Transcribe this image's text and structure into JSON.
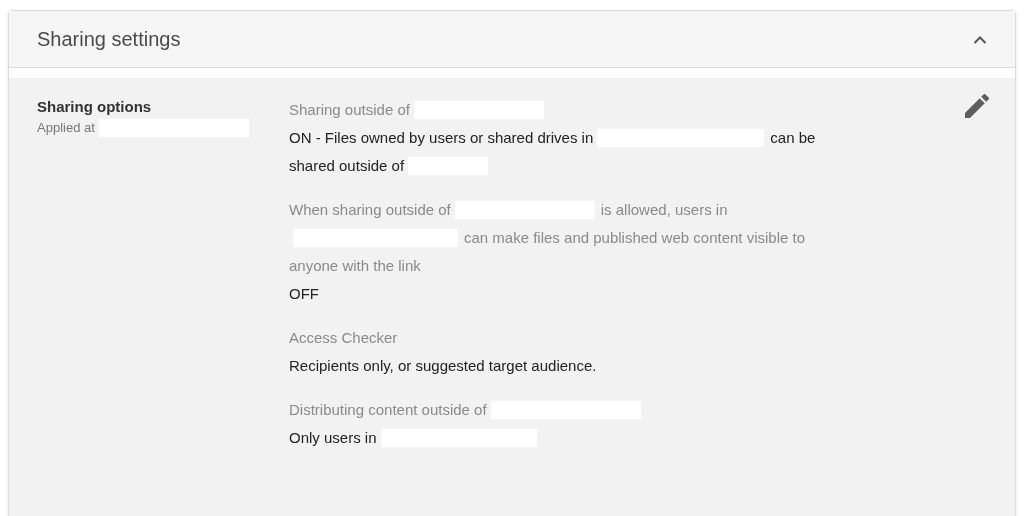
{
  "panel": {
    "title": "Sharing settings",
    "expanded": true
  },
  "section": {
    "title": "Sharing options",
    "applied_at": [
      {
        "kind": "text",
        "text": "Applied at"
      },
      {
        "kind": "redaction"
      }
    ]
  },
  "settings": [
    {
      "label": [
        [
          {
            "kind": "text",
            "text": "Sharing outside of"
          },
          {
            "kind": "redaction"
          }
        ]
      ],
      "value": [
        [
          {
            "kind": "text",
            "text": "ON - Files owned by users or shared drives in"
          },
          {
            "kind": "redaction"
          },
          {
            "kind": "text",
            "text": "can be"
          }
        ],
        [
          {
            "kind": "text",
            "text": "shared outside of"
          },
          {
            "kind": "redaction"
          }
        ]
      ]
    },
    {
      "label": [
        [
          {
            "kind": "text",
            "text": "When sharing outside of"
          },
          {
            "kind": "redaction"
          },
          {
            "kind": "text",
            "text": "is allowed, users in"
          }
        ],
        [
          {
            "kind": "redaction"
          },
          {
            "kind": "text",
            "text": "can make files and published web content visible to"
          }
        ],
        [
          {
            "kind": "text",
            "text": "anyone with the link"
          }
        ]
      ],
      "value": [
        [
          {
            "kind": "text",
            "text": "OFF"
          }
        ]
      ]
    },
    {
      "label": [
        [
          {
            "kind": "text",
            "text": "Access Checker"
          }
        ]
      ],
      "value": [
        [
          {
            "kind": "text",
            "text": "Recipients only, or suggested target audience."
          }
        ]
      ]
    },
    {
      "label": [
        [
          {
            "kind": "text",
            "text": "Distributing content outside of"
          },
          {
            "kind": "redaction"
          }
        ]
      ],
      "value": [
        [
          {
            "kind": "text",
            "text": "Only users in"
          },
          {
            "kind": "redaction"
          }
        ]
      ]
    }
  ]
}
